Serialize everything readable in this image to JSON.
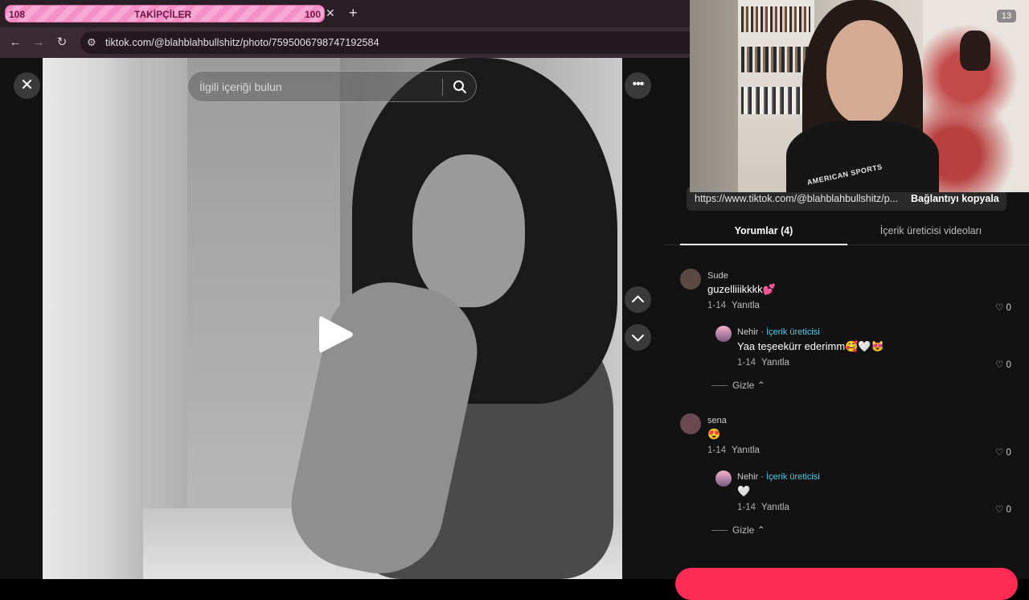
{
  "browser": {
    "tab": {
      "count_left": "108",
      "title": "TAKİPÇİLER",
      "count_right": "100"
    },
    "url": "tiktok.com/@blahblahbullshitz/photo/7595006798747192584"
  },
  "viewer": {
    "search_placeholder": "İlgili içeriği bulun"
  },
  "share": {
    "link_url": "https://www.tiktok.com/@blahblahbullshitz/p...",
    "copy_label": "Bağlantıyı kopyala"
  },
  "tabs": {
    "comments": "Yorumlar (4)",
    "creator_videos": "İçerik üreticisi videoları"
  },
  "comments": [
    {
      "user": "Sude",
      "text": "guzelliiikkkk💕",
      "date": "1-14",
      "reply": "Yanıtla",
      "likes": "0",
      "replies": [
        {
          "user": "Nehir",
          "creator_tag": "İçerik üreticisi",
          "text": "Yaa teşeekürr ederimm🥰🤍😻",
          "date": "1-14",
          "reply": "Yanıtla",
          "likes": "0"
        }
      ],
      "hide_label": "Gizle"
    },
    {
      "user": "sena",
      "text": "😍",
      "date": "1-14",
      "reply": "Yanıtla",
      "likes": "0",
      "replies": [
        {
          "user": "Nehir",
          "creator_tag": "İçerik üreticisi",
          "text": "🤍",
          "date": "1-14",
          "reply": "Yanıtla",
          "likes": "0"
        }
      ],
      "hide_label": "Gizle"
    }
  ],
  "webcam": {
    "badge": "13",
    "shirt_text": "AMERICAN SPORTS"
  },
  "colors": {
    "accent": "#fe2c55",
    "creator": "#4fc7e6",
    "tab_pink": "#f58fc8"
  },
  "icons": {
    "close": "close-icon",
    "search": "search-icon",
    "more": "more-icon",
    "play": "play-icon",
    "up": "chevron-up-icon",
    "down": "chevron-down-icon",
    "heart": "heart-icon"
  }
}
